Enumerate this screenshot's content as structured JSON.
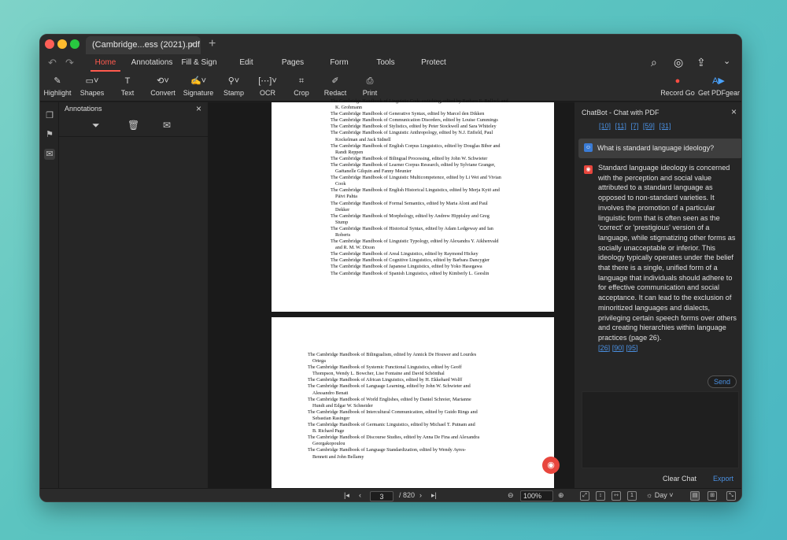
{
  "tab": {
    "title": "(Cambridge...ess (2021).pdf",
    "close": "×",
    "new": "+"
  },
  "menu": [
    "Home",
    "Annotations",
    "Fill & Sign",
    "Edit",
    "Pages",
    "Form",
    "Tools",
    "Protect"
  ],
  "toolbar": {
    "highlight": "Highlight",
    "shapes": "Shapes",
    "text": "Text",
    "convert": "Convert",
    "signature": "Signature",
    "stamp": "Stamp",
    "ocr": "OCR",
    "crop": "Crop",
    "redact": "Redact",
    "print": "Print",
    "record": "Record Go",
    "get_pdfgear": "Get PDFgear"
  },
  "annotations": {
    "title": "Annotations",
    "close": "×"
  },
  "page1_lines": [
    {
      "t": "The Cambridge Handbook of Linguistic Code-switching, edited by Barbara E. Bullock and",
      "i": false
    },
    {
      "t": "K. Grohmann",
      "i": true
    },
    {
      "t": "The Cambridge Handbook of Generative Syntax, edited by Marcel den Dikken",
      "i": false
    },
    {
      "t": "The Cambridge Handbook of Communication Disorders, edited by Louise Cummings",
      "i": false
    },
    {
      "t": "The Cambridge Handbook of Stylistics, edited by Peter Stockwell and Sara Whiteley",
      "i": false
    },
    {
      "t": "The Cambridge Handbook of Linguistic Anthropology, edited by N.J. Enfield, Paul",
      "i": false
    },
    {
      "t": "Kockelman and Jack Sidnell",
      "i": true
    },
    {
      "t": "The Cambridge Handbook of English Corpus Linguistics, edited by Douglas Biber and",
      "i": false
    },
    {
      "t": "Randi Reppen",
      "i": true
    },
    {
      "t": "The Cambridge Handbook of Bilingual Processing, edited by John W. Schwieter",
      "i": false
    },
    {
      "t": "The Cambridge Handbook of Learner Corpus Research, edited by Sylviane Granger,",
      "i": false
    },
    {
      "t": "Gaëtanelle Gilquin and Fanny Meunier",
      "i": true
    },
    {
      "t": "The Cambridge Handbook of Linguistic Multicompetence, edited by Li Wei and Vivian",
      "i": false
    },
    {
      "t": "Cook",
      "i": true
    },
    {
      "t": "The Cambridge Handbook of English Historical Linguistics, edited by Merja Kytö and",
      "i": false
    },
    {
      "t": "Päivi Pahta",
      "i": true
    },
    {
      "t": "The Cambridge Handbook of Formal Semantics, edited by Maria Aloni and Paul",
      "i": false
    },
    {
      "t": "Dekker",
      "i": true
    },
    {
      "t": "The Cambridge Handbook of Morphology, edited by Andrew Hippisley and Greg",
      "i": false
    },
    {
      "t": "Stump",
      "i": true
    },
    {
      "t": "The Cambridge Handbook of Historical Syntax, edited by Adam Ledgeway and Ian",
      "i": false
    },
    {
      "t": "Roberts",
      "i": true
    },
    {
      "t": "The Cambridge Handbook of Linguistic Typology, edited by Alexandra Y. Aikhenvald",
      "i": false
    },
    {
      "t": "and R. M. W. Dixon",
      "i": true
    },
    {
      "t": "The Cambridge Handbook of Areal Linguistics, edited by Raymond Hickey",
      "i": false
    },
    {
      "t": "The Cambridge Handbook of Cognitive Linguistics, edited by Barbara Dancygier",
      "i": false
    },
    {
      "t": "The Cambridge Handbook of Japanese Linguistics, edited by Yoko Hasegawa",
      "i": false
    },
    {
      "t": "The Cambridge Handbook of Spanish Linguistics, edited by Kimberly L. Geeslin",
      "i": false
    }
  ],
  "page2_lines": [
    {
      "t": "The Cambridge Handbook of Bilingualism, edited by Annick De Houwer and Lourdes",
      "i": false
    },
    {
      "t": "Ortega",
      "i": true
    },
    {
      "t": "The Cambridge Handbook of Systemic Functional Linguistics, edited by Geoff",
      "i": false
    },
    {
      "t": "Thompson, Wendy L. Bowcher, Lise Fontaine and David Schönthal",
      "i": true
    },
    {
      "t": "The Cambridge Handbook of African Linguistics, edited by H. Ekkehard Wolff",
      "i": false
    },
    {
      "t": "The Cambridge Handbook of Language Learning, edited by John W. Schwieter and",
      "i": false
    },
    {
      "t": "Alessandro Benati",
      "i": true
    },
    {
      "t": "The Cambridge Handbook of World Englishes, edited by Daniel Schreier, Marianne",
      "i": false
    },
    {
      "t": "Hundt and Edgar W. Schneider",
      "i": true
    },
    {
      "t": "The Cambridge Handbook of Intercultural Communication, edited by Guido Rings and",
      "i": false
    },
    {
      "t": "Sebastian Rasinger",
      "i": true
    },
    {
      "t": "The Cambridge Handbook of Germanic Linguistics, edited by Michael T. Putnam and",
      "i": false
    },
    {
      "t": "B. Richard Page",
      "i": true
    },
    {
      "t": "The Cambridge Handbook of Discourse Studies, edited by Anna De Fina and Alexandra",
      "i": false
    },
    {
      "t": "Georgakopoulou",
      "i": true
    },
    {
      "t": "The Cambridge Handbook of Language Standardization, edited by Wendy Ayres-",
      "i": false
    },
    {
      "t": "Bennett and John Bellamy",
      "i": true
    }
  ],
  "chat": {
    "title": "ChatBot - Chat with PDF",
    "close": "×",
    "top_refs": [
      "[10]",
      "[11]",
      "[7]",
      "[59]",
      "[31]"
    ],
    "question": "What is standard language ideology?",
    "answer": "Standard language ideology is concerned with the perception and social value attributed to a standard language as opposed to non-standard varieties. It involves the promotion of a particular linguistic form that is often seen as the 'correct' or 'prestigious' version of a language, while stigmatizing other forms as socially unacceptable or inferior. This ideology typically operates under the belief that there is a single, unified form of a language that individuals should adhere to for effective communication and social acceptance. It can lead to the exclusion of minoritized languages and dialects, privileging certain speech forms over others and creating hierarchies within language practices (page 26).",
    "answer_refs": [
      "[26]",
      "[90]",
      "[95]"
    ],
    "send": "Send",
    "input_value": "",
    "clear": "Clear Chat",
    "export": "Export"
  },
  "status": {
    "current_page": "3",
    "total_pages": "/ 820",
    "zoom": "100%",
    "theme": "Day"
  },
  "colors": {
    "accent": "#ff5a4e",
    "link": "#4a90e2"
  }
}
